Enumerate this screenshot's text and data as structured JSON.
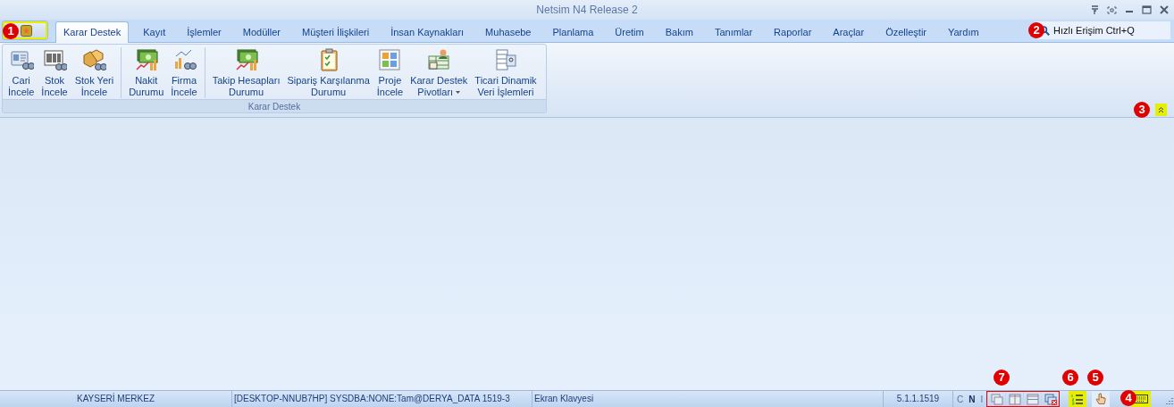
{
  "window": {
    "title": "Netsim N4 Release 2",
    "app_button": {
      "highlighted": true
    }
  },
  "tabs": [
    {
      "label": "Karar Destek",
      "selected": true
    },
    {
      "label": "Kayıt",
      "selected": false
    },
    {
      "label": "İşlemler",
      "selected": false
    },
    {
      "label": "Modüller",
      "selected": false
    },
    {
      "label": "Müşteri İlişkileri",
      "selected": false
    },
    {
      "label": "İnsan Kaynakları",
      "selected": false
    },
    {
      "label": "Muhasebe",
      "selected": false
    },
    {
      "label": "Planlama",
      "selected": false
    },
    {
      "label": "Üretim",
      "selected": false
    },
    {
      "label": "Bakım",
      "selected": false
    },
    {
      "label": "Tanımlar",
      "selected": false
    },
    {
      "label": "Raporlar",
      "selected": false
    },
    {
      "label": "Araçlar",
      "selected": false
    },
    {
      "label": "Özelleştir",
      "selected": false
    },
    {
      "label": "Yardım",
      "selected": false
    }
  ],
  "quick_access": {
    "label": "Hızlı Erişim Ctrl+Q"
  },
  "ribbon": {
    "group": "Karar Destek",
    "collapse_highlighted": true,
    "buttons": [
      {
        "lines": [
          "Cari",
          "İncele"
        ],
        "separator_before": false,
        "dropdown": false
      },
      {
        "lines": [
          "Stok",
          "İncele"
        ],
        "separator_before": false,
        "dropdown": false
      },
      {
        "lines": [
          "Stok Yeri",
          "İncele"
        ],
        "separator_before": false,
        "dropdown": false
      },
      {
        "lines": [
          "Nakit",
          "Durumu"
        ],
        "separator_before": true,
        "dropdown": false
      },
      {
        "lines": [
          "Firma",
          "İncele"
        ],
        "separator_before": false,
        "dropdown": false
      },
      {
        "lines": [
          "Takip Hesapları",
          "Durumu"
        ],
        "separator_before": true,
        "dropdown": false
      },
      {
        "lines": [
          "Sipariş Karşılanma",
          "Durumu"
        ],
        "separator_before": false,
        "dropdown": false
      },
      {
        "lines": [
          "Proje",
          "İncele"
        ],
        "separator_before": false,
        "dropdown": false
      },
      {
        "lines": [
          "Karar Destek",
          "Pivotları"
        ],
        "separator_before": false,
        "dropdown": true
      },
      {
        "lines": [
          "Ticari Dinamik",
          "Veri İşlemleri"
        ],
        "separator_before": false,
        "dropdown": false
      }
    ]
  },
  "status_bar": {
    "branch": "KAYSERİ MERKEZ",
    "connection": "[DESKTOP-NNUB7HP] SYSDBA:NONE:Tam@DERYA_DATA 1519-3",
    "keyboard_label": "Ekran Klavyesi",
    "version": "5.1.1.1519",
    "indicators": [
      {
        "label": "C",
        "on": false
      },
      {
        "label": "N",
        "on": true
      },
      {
        "label": "I",
        "on": false
      }
    ],
    "window_buttons": [
      {
        "highlighted": false
      },
      {
        "highlighted": false
      },
      {
        "highlighted": false
      },
      {
        "highlighted": false
      }
    ],
    "list_button": {
      "highlighted": true
    },
    "hand_button": {
      "highlighted": false
    },
    "keyboard_button": {
      "highlighted": true
    }
  },
  "callouts": [
    "1",
    "2",
    "3",
    "7",
    "6",
    "5",
    "4"
  ]
}
